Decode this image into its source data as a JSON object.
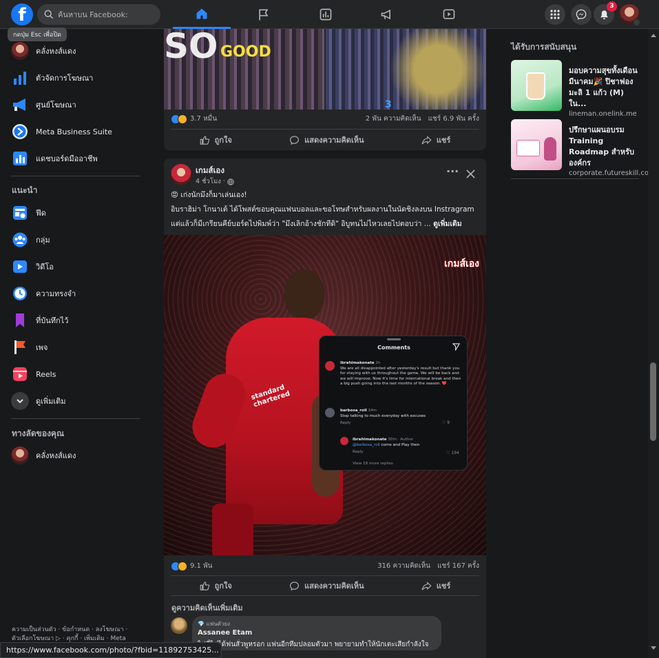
{
  "topbar": {
    "logo": "f",
    "search_placeholder": "ค้นหาบน Facebook:",
    "tooltip": "กดปุ่ม Esc เพื่อปิด",
    "notification_count": "3",
    "nav_icons": [
      "home-icon",
      "flag-icon",
      "chart-icon",
      "megaphone-icon",
      "video-icon"
    ]
  },
  "sidebar": {
    "items": [
      {
        "label": "คลั่งหงส์แดง",
        "icon": "profile-avatar"
      },
      {
        "label": "ตัวจัดการโฆษณา",
        "icon": "bar-chart-icon"
      },
      {
        "label": "ศูนย์โฆษณา",
        "icon": "megaphone-icon"
      },
      {
        "label": "Meta Business Suite",
        "icon": "business-suite-icon"
      },
      {
        "label": "แดชบอร์ดมืออาชีพ",
        "icon": "dashboard-icon"
      }
    ],
    "suggested_heading": "แนะนำ",
    "suggested": [
      {
        "label": "ฟีด"
      },
      {
        "label": "กลุ่ม"
      },
      {
        "label": "วิดีโอ"
      },
      {
        "label": "ความทรงจำ"
      },
      {
        "label": "ที่บันทึกไว้"
      },
      {
        "label": "เพจ"
      },
      {
        "label": "Reels"
      },
      {
        "label": "ดูเพิ่มเติม"
      }
    ],
    "shortcuts_heading": "ทางลัดของคุณ",
    "shortcuts": [
      {
        "label": "คลั่งหงส์แดง"
      }
    ],
    "footer_line1": "ความเป็นส่วนตัว · ข้อกำหนด · ลงโฆษณา ·",
    "footer_line2": "ตัวเลือกโฆษณา ▷ · คุกกี้ · เพิ่มเติม · Meta"
  },
  "post1": {
    "image_caption": "GOOD",
    "reaction_count": "3.7 หมื่น",
    "comment_count": "2 พัน ความคิดเห็น",
    "share_count": "แชร์ 6.9 พัน ครั้ง"
  },
  "actions": {
    "like": "ถูกใจ",
    "comment": "แสดงความคิดเห็น",
    "share": "แชร์"
  },
  "post2": {
    "author": "เกมส์เอง",
    "time": "4 ชั่วโมง ·",
    "line1": "😡 เก่งนักมึงก็มาเล่นเอง!",
    "line2": "อิบราฮิม่า โกนาเต้ ได้โพสต์ขอบคุณแฟนบอลและขอโทษสำหรับผลงานในนัดชิงลงบน Instragram",
    "line3": "แต่แล้วก็มีเกรียนคีย์บอร์ดไปพิมพ์ว่า \"มึงเลิกอ้างชักทีดิ\" อิบูทนไม่ไหวเลยไปตอบว่า ...",
    "see_more": "ดูเพิ่มเติม",
    "reaction_count": "9.1 พัน",
    "comment_count": "316 ความคิดเห็น",
    "share_count": "แชร์ 167 ครั้ง",
    "view_more_comments": "ดูความคิดเห็นเพิ่มเติม",
    "comment": {
      "badge": "แฟนตัวยง",
      "name": "Assanee Etam",
      "text": "ไปที่ไม่ได้ฟนสั่วพูหรอก แฟนอีกทีมปลอมตัวมา พยายามทำให้นักเตะเสียกำลังใจ"
    }
  },
  "ig_overlay": {
    "title": "Comments",
    "c1_user": "ibrahimakonate",
    "c1_time": "2h",
    "c1_text": "We are all disappointed after yesterday's result but thank you for staying with us throughout the game. We will be back and we will improve. Now it's time for international break and then a big push going into the last months of the season. ❤️",
    "c2_user": "barbosa_roll",
    "c2_time": "34m",
    "c2_text": "Stop talking to much everyday with excuses",
    "c2_likes": "9",
    "reply_label": "Reply",
    "c3_user": "ibrahimakonate",
    "c3_meta": "30m · Author",
    "c3_mention": "@barbosa_roll",
    "c3_text": "come and Play then",
    "c3_likes": "194",
    "view_replies": "View 18 more replies",
    "watermark": "เกมส์เอง"
  },
  "sponsored": {
    "heading": "ได้รับการสนับสนุน",
    "ads": [
      {
        "title": "มอบความสุขทั้งเดือนมีนาคม🎉 ปิชาฟอง มะลิ 1 แก้ว (M) ใน...",
        "url": "lineman.onelink.me"
      },
      {
        "title": "ปรึกษาแผนอบรม Training Roadmap สำหรับองค์กร",
        "url": "corporate.futureskill.co"
      }
    ]
  },
  "statusbar": {
    "url": "https://www.facebook.com/photo/?fbid=11892753425..."
  },
  "colors": {
    "accent": "#2d88ff",
    "background": "#18191a",
    "card": "#242526",
    "badge": "#e41e3f"
  }
}
